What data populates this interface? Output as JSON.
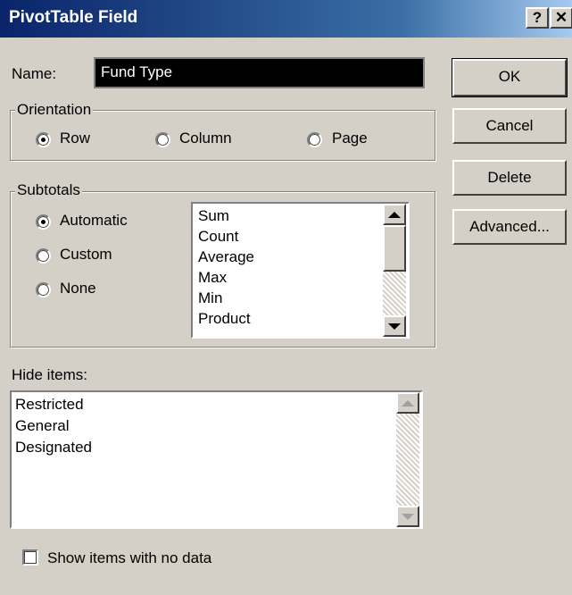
{
  "window": {
    "title": "PivotTable Field",
    "help_label": "?",
    "close_label": "✕"
  },
  "name_field": {
    "label": "Name:",
    "value": "Fund Type"
  },
  "orientation": {
    "label": "Orientation",
    "options": [
      {
        "label": "Row",
        "selected": true
      },
      {
        "label": "Column",
        "selected": false
      },
      {
        "label": "Page",
        "selected": false
      }
    ]
  },
  "subtotals": {
    "label": "Subtotals",
    "options": [
      {
        "label": "Automatic",
        "selected": true
      },
      {
        "label": "Custom",
        "selected": false
      },
      {
        "label": "None",
        "selected": false
      }
    ],
    "functions": [
      "Sum",
      "Count",
      "Average",
      "Max",
      "Min",
      "Product"
    ]
  },
  "hide_items": {
    "label": "Hide items:",
    "items": [
      "Restricted",
      "General",
      "Designated"
    ]
  },
  "show_empty": {
    "label": "Show items with no data",
    "checked": false
  },
  "buttons": {
    "ok": "OK",
    "cancel": "Cancel",
    "delete": "Delete",
    "advanced": "Advanced..."
  }
}
